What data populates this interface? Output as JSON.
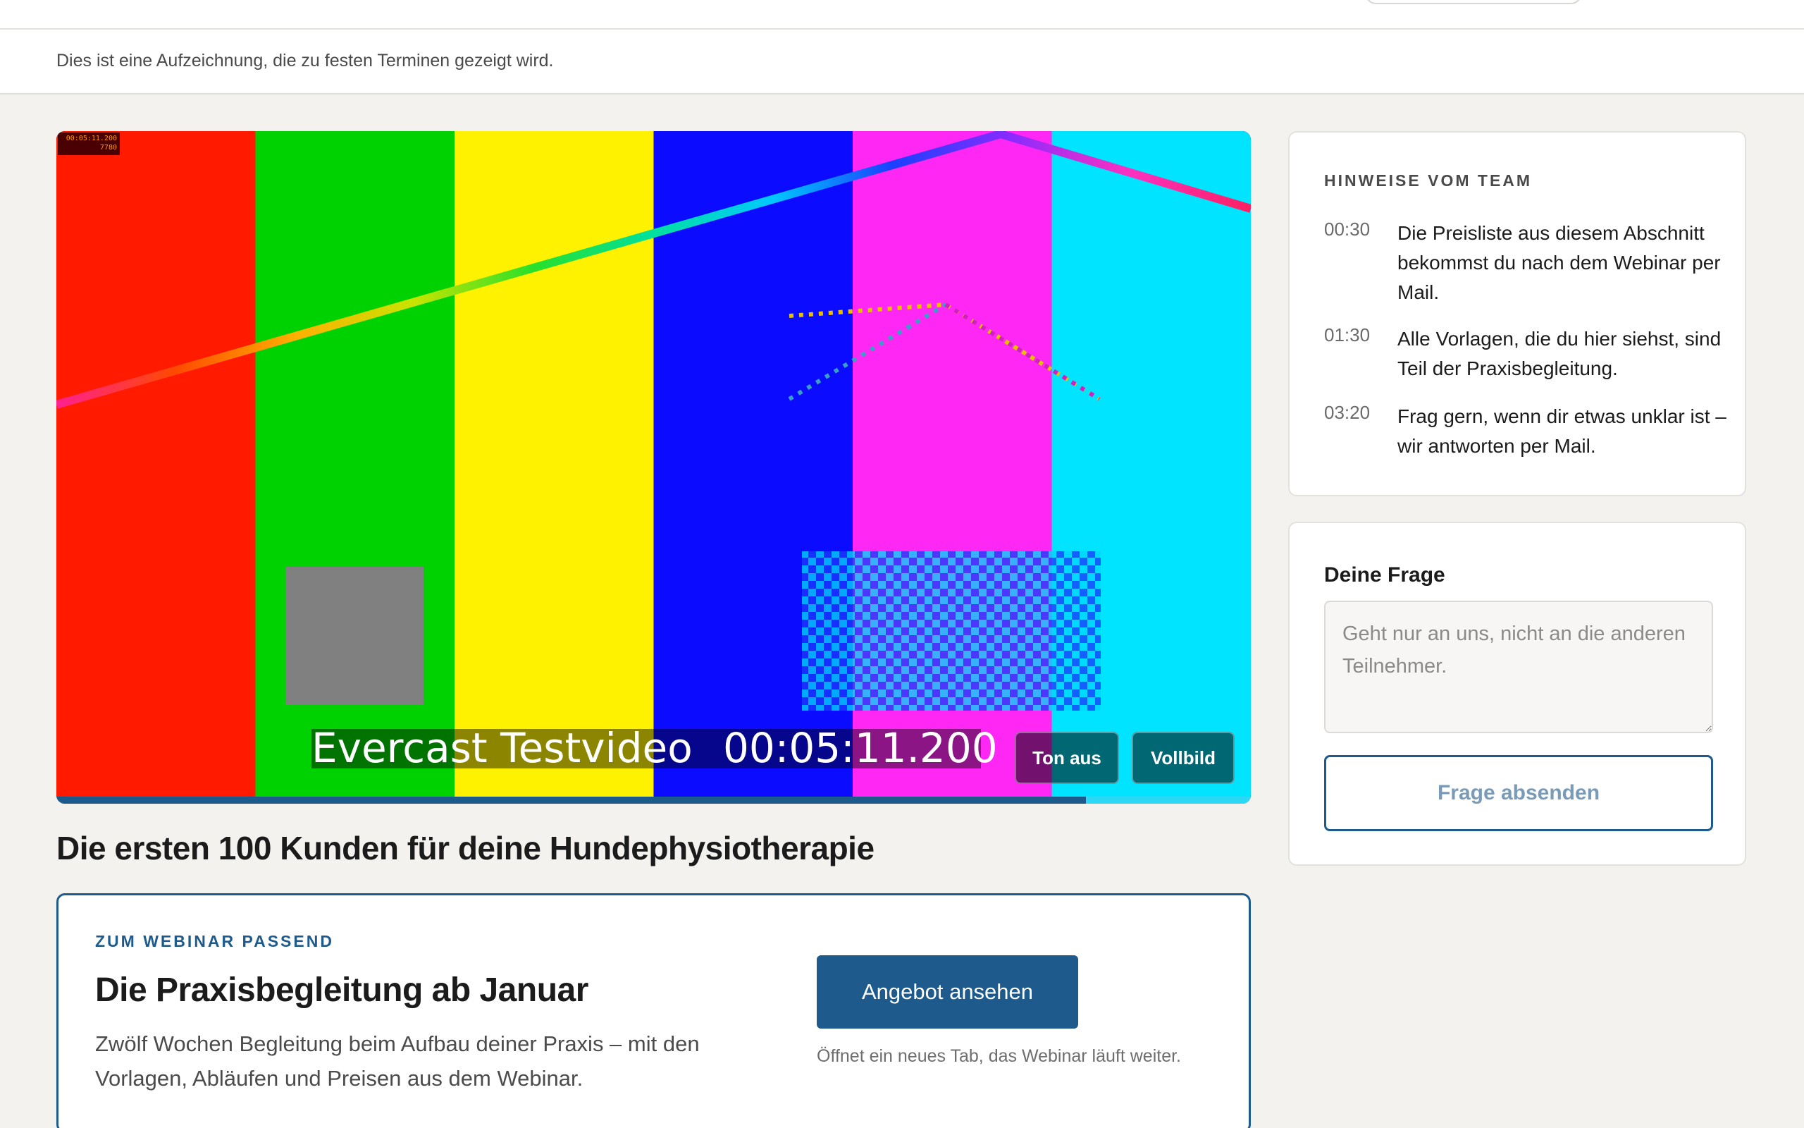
{
  "notice": {
    "text": "Dies ist eine Aufzeichnung, die zu festen Terminen gezeigt wird."
  },
  "video": {
    "timecode_box": [
      "00:05:11.200",
      "7780"
    ],
    "overlay_title": "Evercast Testvideo",
    "overlay_time": "00:05:11.200",
    "mute_label": "Ton aus",
    "fullscreen_label": "Vollbild",
    "progress": 0.862,
    "colors": {
      "bars": [
        "#ff1a00",
        "#00d100",
        "#fff200",
        "#0b0bff",
        "#ff27f4",
        "#00e4ff"
      ],
      "checker_a": "#00d6ff",
      "checker_b": "#1a3bff",
      "gray_square": "#808080",
      "progress_fill": "#1b5a8a",
      "progress_track": "#2cd8f3"
    }
  },
  "headline": "Die ersten 100 Kunden für deine Hundephysiotherapie",
  "offer": {
    "kicker": "ZUM WEBINAR PASSEND",
    "title": "Die Praxisbegleitung ab Januar",
    "description": "Zwölf Wochen Begleitung beim Aufbau deiner Praxis – mit den Vorlagen, Abläufen und Preisen aus dem Webinar.",
    "cta_label": "Angebot ansehen",
    "cta_note": "Öffnet ein neues Tab, das Webinar läuft weiter.",
    "accent": "#1e5b8c"
  },
  "team_notes": {
    "heading": "HINWEISE VOM TEAM",
    "items": [
      {
        "time": "00:30",
        "text": "Die Preisliste aus diesem Abschnitt bekommst du nach dem Webinar per Mail."
      },
      {
        "time": "01:30",
        "text": "Alle Vorlagen, die du hier siehst, sind Teil der Praxisbegleitung."
      },
      {
        "time": "03:20",
        "text": "Frag gern, wenn dir etwas unklar ist – wir antworten per Mail."
      }
    ]
  },
  "question": {
    "label": "Deine Frage",
    "placeholder": "Geht nur an uns, nicht an die anderen Teilnehmer.",
    "value": "",
    "send_label": "Frage absenden"
  }
}
